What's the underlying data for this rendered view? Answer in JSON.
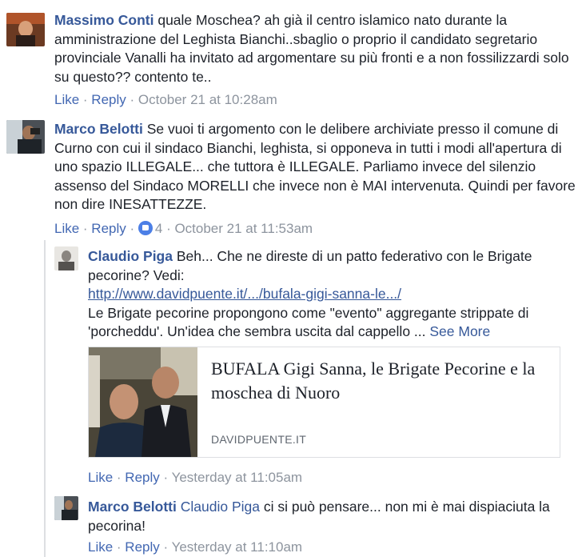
{
  "comments": [
    {
      "author": "Massimo Conti",
      "text": " quale Moschea? ah già il centro islamico nato durante la amministrazione del Leghista Bianchi..sbaglio o proprio il candidato segretario provinciale Vanalli ha invitato ad argomentare su più fronti e a non fossilizzardi solo su questo?? contento te..",
      "like": "Like",
      "reply": "Reply",
      "time": "October 21 at 10:28am"
    },
    {
      "author": "Marco Belotti",
      "text": " Se vuoi ti argomento con le delibere archiviate presso il comune di Curno con cui il sindaco Bianchi, leghista, si opponeva in tutti i modi all'apertura di uno spazio ILLEGALE... che tuttora è ILLEGALE. Parliamo invece del silenzio assenso del Sindaco MORELLI che invece non è MAI intervenuta. Quindi per favore non dire INESATTEZZE.",
      "like": "Like",
      "reply": "Reply",
      "reactions": "4",
      "time": "October 21 at 11:53am"
    }
  ],
  "replies": [
    {
      "author": "Claudio Piga",
      "text": " Beh... Che ne direste di un patto federativo con le Brigate pecorine? Vedi:",
      "url": "http://www.davidpuente.it/.../bufala-gigi-sanna-le.../",
      "text2": "Le Brigate pecorine propongono come \"evento\" aggregante strippate di 'porcheddu'. Un'idea che sembra uscita dal cappello ...",
      "see_more": "See More",
      "card": {
        "title": "BUFALA Gigi Sanna, le Brigate Pecorine e la moschea di Nuoro",
        "domain": "DAVIDPUENTE.IT"
      },
      "like": "Like",
      "reply": "Reply",
      "time": "Yesterday at 11:05am"
    },
    {
      "author": "Marco Belotti",
      "mention": "Claudio Piga",
      "text": " ci si può pensare... non mi è mai dispiaciuta la pecorina!",
      "like": "Like",
      "reply": "Reply",
      "time": "Yesterday at 11:10am"
    }
  ],
  "separator": " · "
}
